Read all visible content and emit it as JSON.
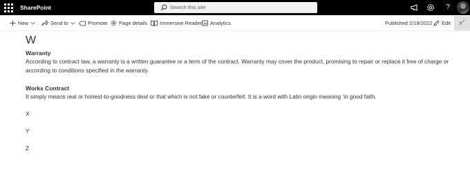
{
  "suite_bar": {
    "app_name": "SharePoint",
    "search_placeholder": "Search this site",
    "icons": [
      "app-launcher-icon",
      "search-icon",
      "megaphone-icon",
      "settings-icon",
      "help-icon",
      "avatar"
    ],
    "help_label": "?"
  },
  "command_bar": {
    "new_label": "New",
    "send_to_label": "Send to",
    "promote_label": "Promote",
    "page_details_label": "Page details",
    "immersive_reader_label": "Immersive Reader",
    "analytics_label": "Analytics",
    "published_label": "Published 2/18/2022",
    "edit_label": "Edit"
  },
  "content": {
    "section_letter": "W",
    "entries": [
      {
        "term": "Warranty",
        "definition": "According to contract law, a warranty is a written guarantee or a term of the contract. Warranty may cover the product, promising to repair or replace it free of charge or according to conditions specified in the warranty."
      },
      {
        "term": "Works Contract",
        "definition": "It simply means real or honest-to-goodness deal or that which is not fake or counterfeit. It is a word with Latin origin meaning ‘in good faith."
      }
    ],
    "letters": [
      "X",
      "Y",
      "Z"
    ]
  },
  "colors": {
    "suite_bar_bg": "#000000",
    "search_bg": "#f3f2f1",
    "text": "#323130",
    "collapse_bg": "#e1dfdd"
  }
}
